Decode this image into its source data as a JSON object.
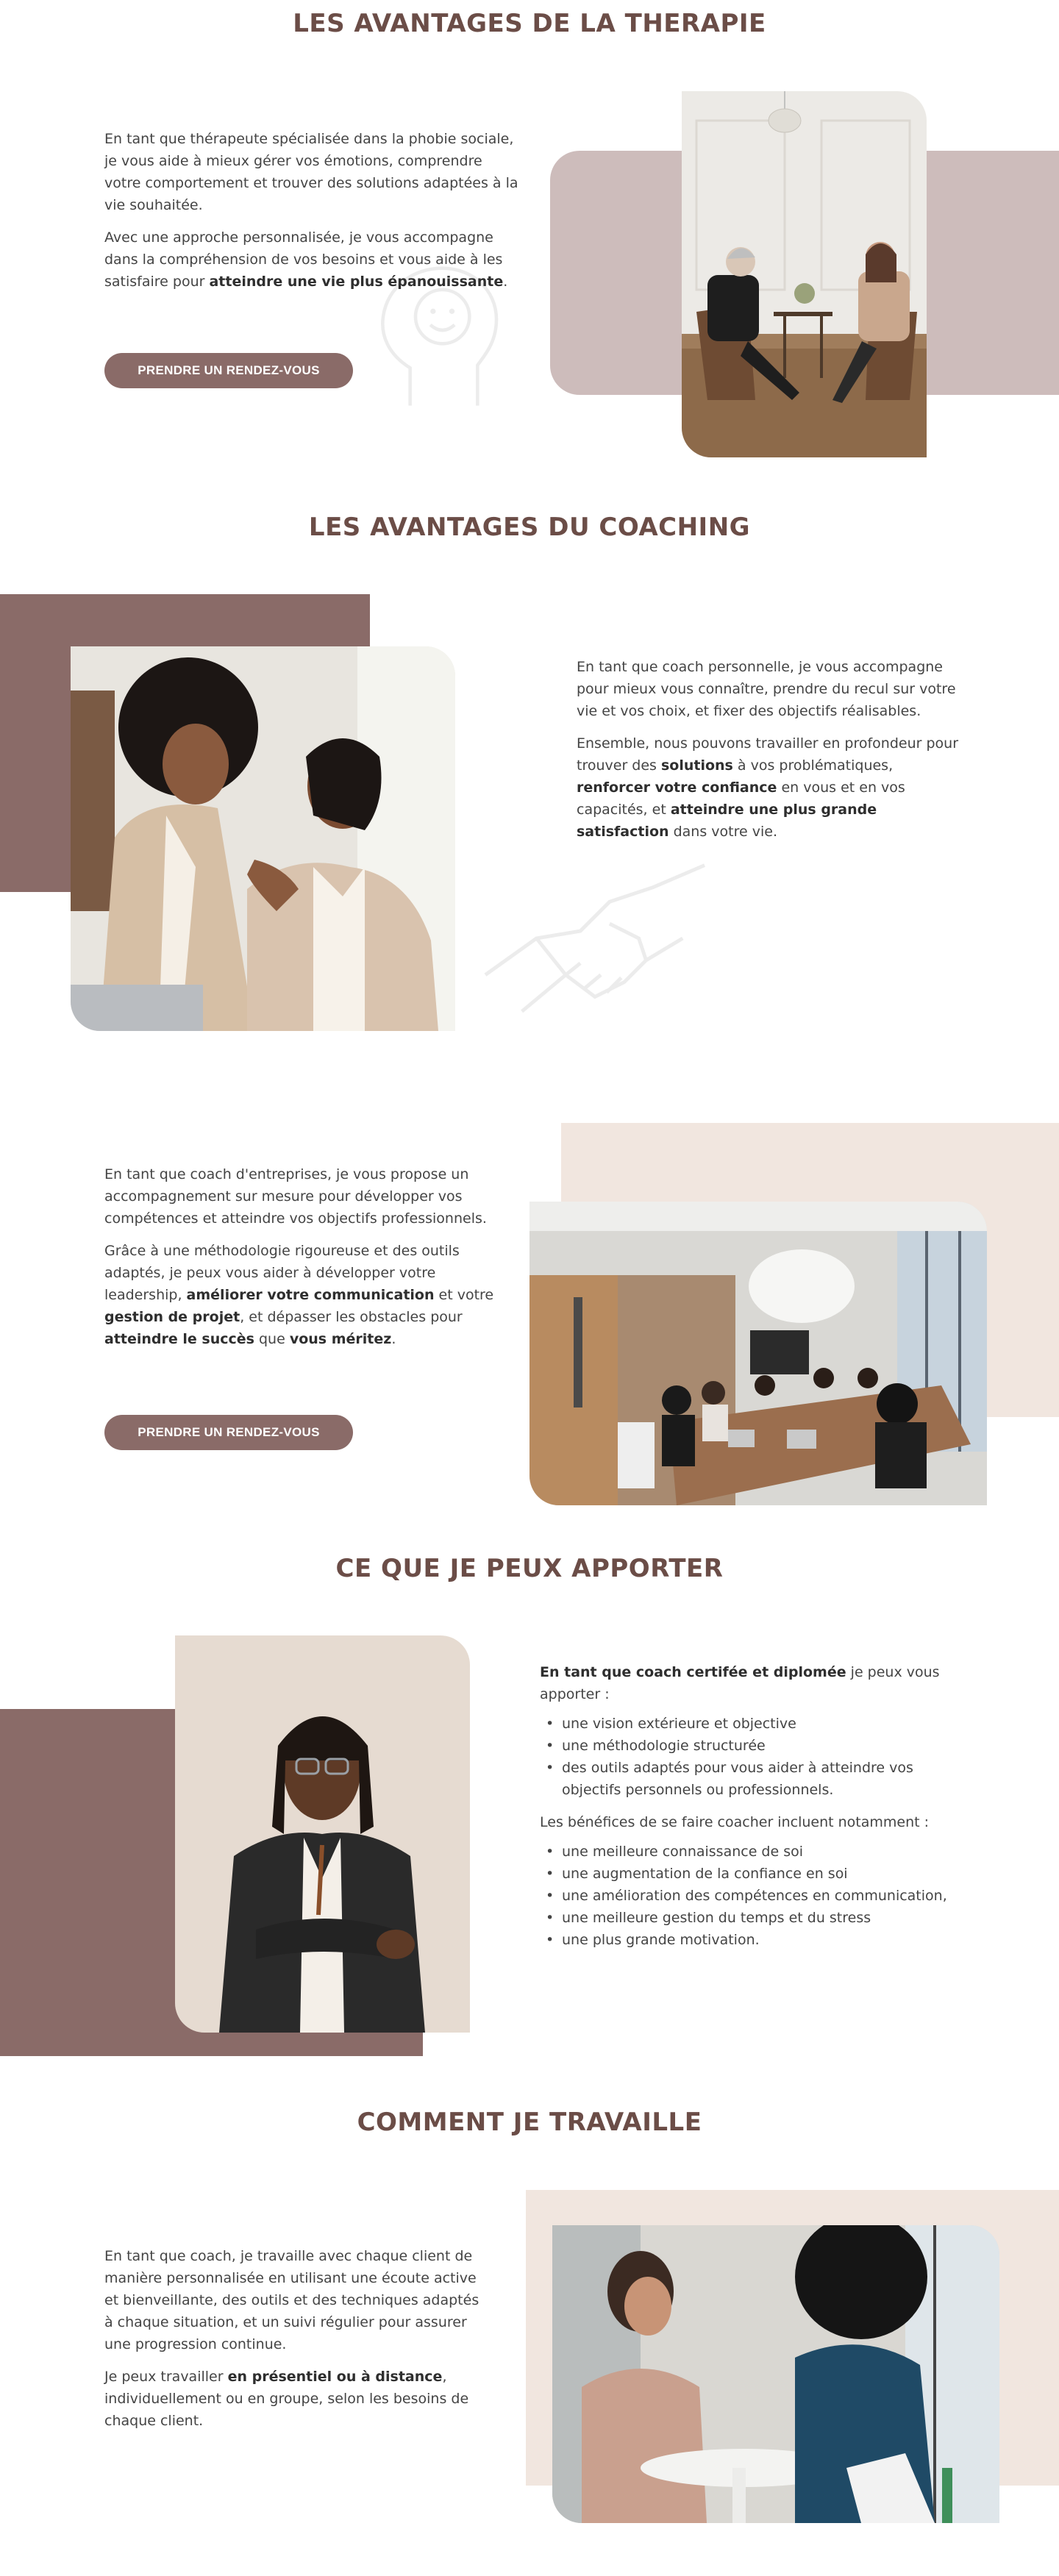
{
  "sections": {
    "therapie": {
      "title": "LES AVANTAGES DE LA THERAPIE",
      "p1": "En tant que thérapeute spécialisée dans la phobie sociale, je vous aide à mieux gérer vos émotions, comprendre votre comportement et trouver des solutions adaptées à la vie souhaitée.",
      "p2_a": "Avec une approche personnalisée, je vous accompagne dans la compréhension de vos besoins et vous aide à les satisfaire pour ",
      "p2_b": "atteindre une vie plus épanouissante",
      "p2_c": ".",
      "button": "PRENDRE UN RENDEZ-VOUS"
    },
    "coaching": {
      "title": "LES AVANTAGES DU COACHING",
      "p1": "En tant que coach personnelle, je vous accompagne pour mieux vous connaître, prendre du recul sur votre vie et vos choix, et fixer des objectifs réalisables.",
      "p2_a": "Ensemble, nous pouvons travailler en profondeur pour trouver des ",
      "p2_b": "solutions",
      "p2_c": " à vos problématiques, ",
      "p2_d": "renforcer votre confiance",
      "p2_e": " en vous et en vos capacités, et ",
      "p2_f": "atteindre une plus grande satisfaction",
      "p2_g": " dans votre vie."
    },
    "entreprise": {
      "p1": "En tant que coach d'entreprises, je vous propose un accompagnement sur mesure pour développer vos compétences et atteindre vos objectifs professionnels.",
      "p2_a": "Grâce à une méthodologie rigoureuse et des outils adaptés, je peux vous aider à développer votre leadership, ",
      "p2_b": "améliorer votre communication",
      "p2_c": " et votre ",
      "p2_d": "gestion de projet",
      "p2_e": ", et dépasser les obstacles pour ",
      "p2_f": "atteindre le succès",
      "p2_g": " que ",
      "p2_h": "vous méritez",
      "p2_i": ".",
      "button": "PRENDRE UN RENDEZ-VOUS"
    },
    "apporter": {
      "title": "CE QUE JE PEUX APPORTER",
      "intro_bold": "En tant que coach certifée et diplomée",
      "intro_rest": " je peux vous apporter :",
      "list1": [
        "une vision extérieure et objective",
        "une méthodologie structurée",
        "des outils adaptés pour vous aider à atteindre vos objectifs personnels ou professionnels."
      ],
      "benefits_intro": "Les bénéfices de se faire coacher incluent notamment :",
      "list2": [
        "une meilleure connaissance de soi",
        "une augmentation de la confiance en soi",
        "une amélioration des compétences en communication,",
        "une meilleure gestion du temps et du stress",
        "une plus grande motivation."
      ]
    },
    "travail": {
      "title": "COMMENT JE TRAVAILLE",
      "p1": "En tant que coach, je travaille avec chaque client de manière personnalisée en utilisant une écoute active et bienveillante, des outils et des techniques adaptés à chaque situation, et un suivi régulier pour assurer une progression continue.",
      "p2_a": "Je peux travailler ",
      "p2_b": "en présentiel ou à distance",
      "p2_c": ", individuellement ou en groupe, selon les besoins de chaque client."
    }
  },
  "colors": {
    "title": "#6b4d47",
    "button": "#8a6b68",
    "mauve_block": "#8a6b68",
    "pink_block": "#cdbcbb",
    "beige_block": "#f1e6df"
  },
  "icons": {
    "therapie_deco": "head-smile-icon",
    "coaching_deco": "handshake-icon"
  }
}
